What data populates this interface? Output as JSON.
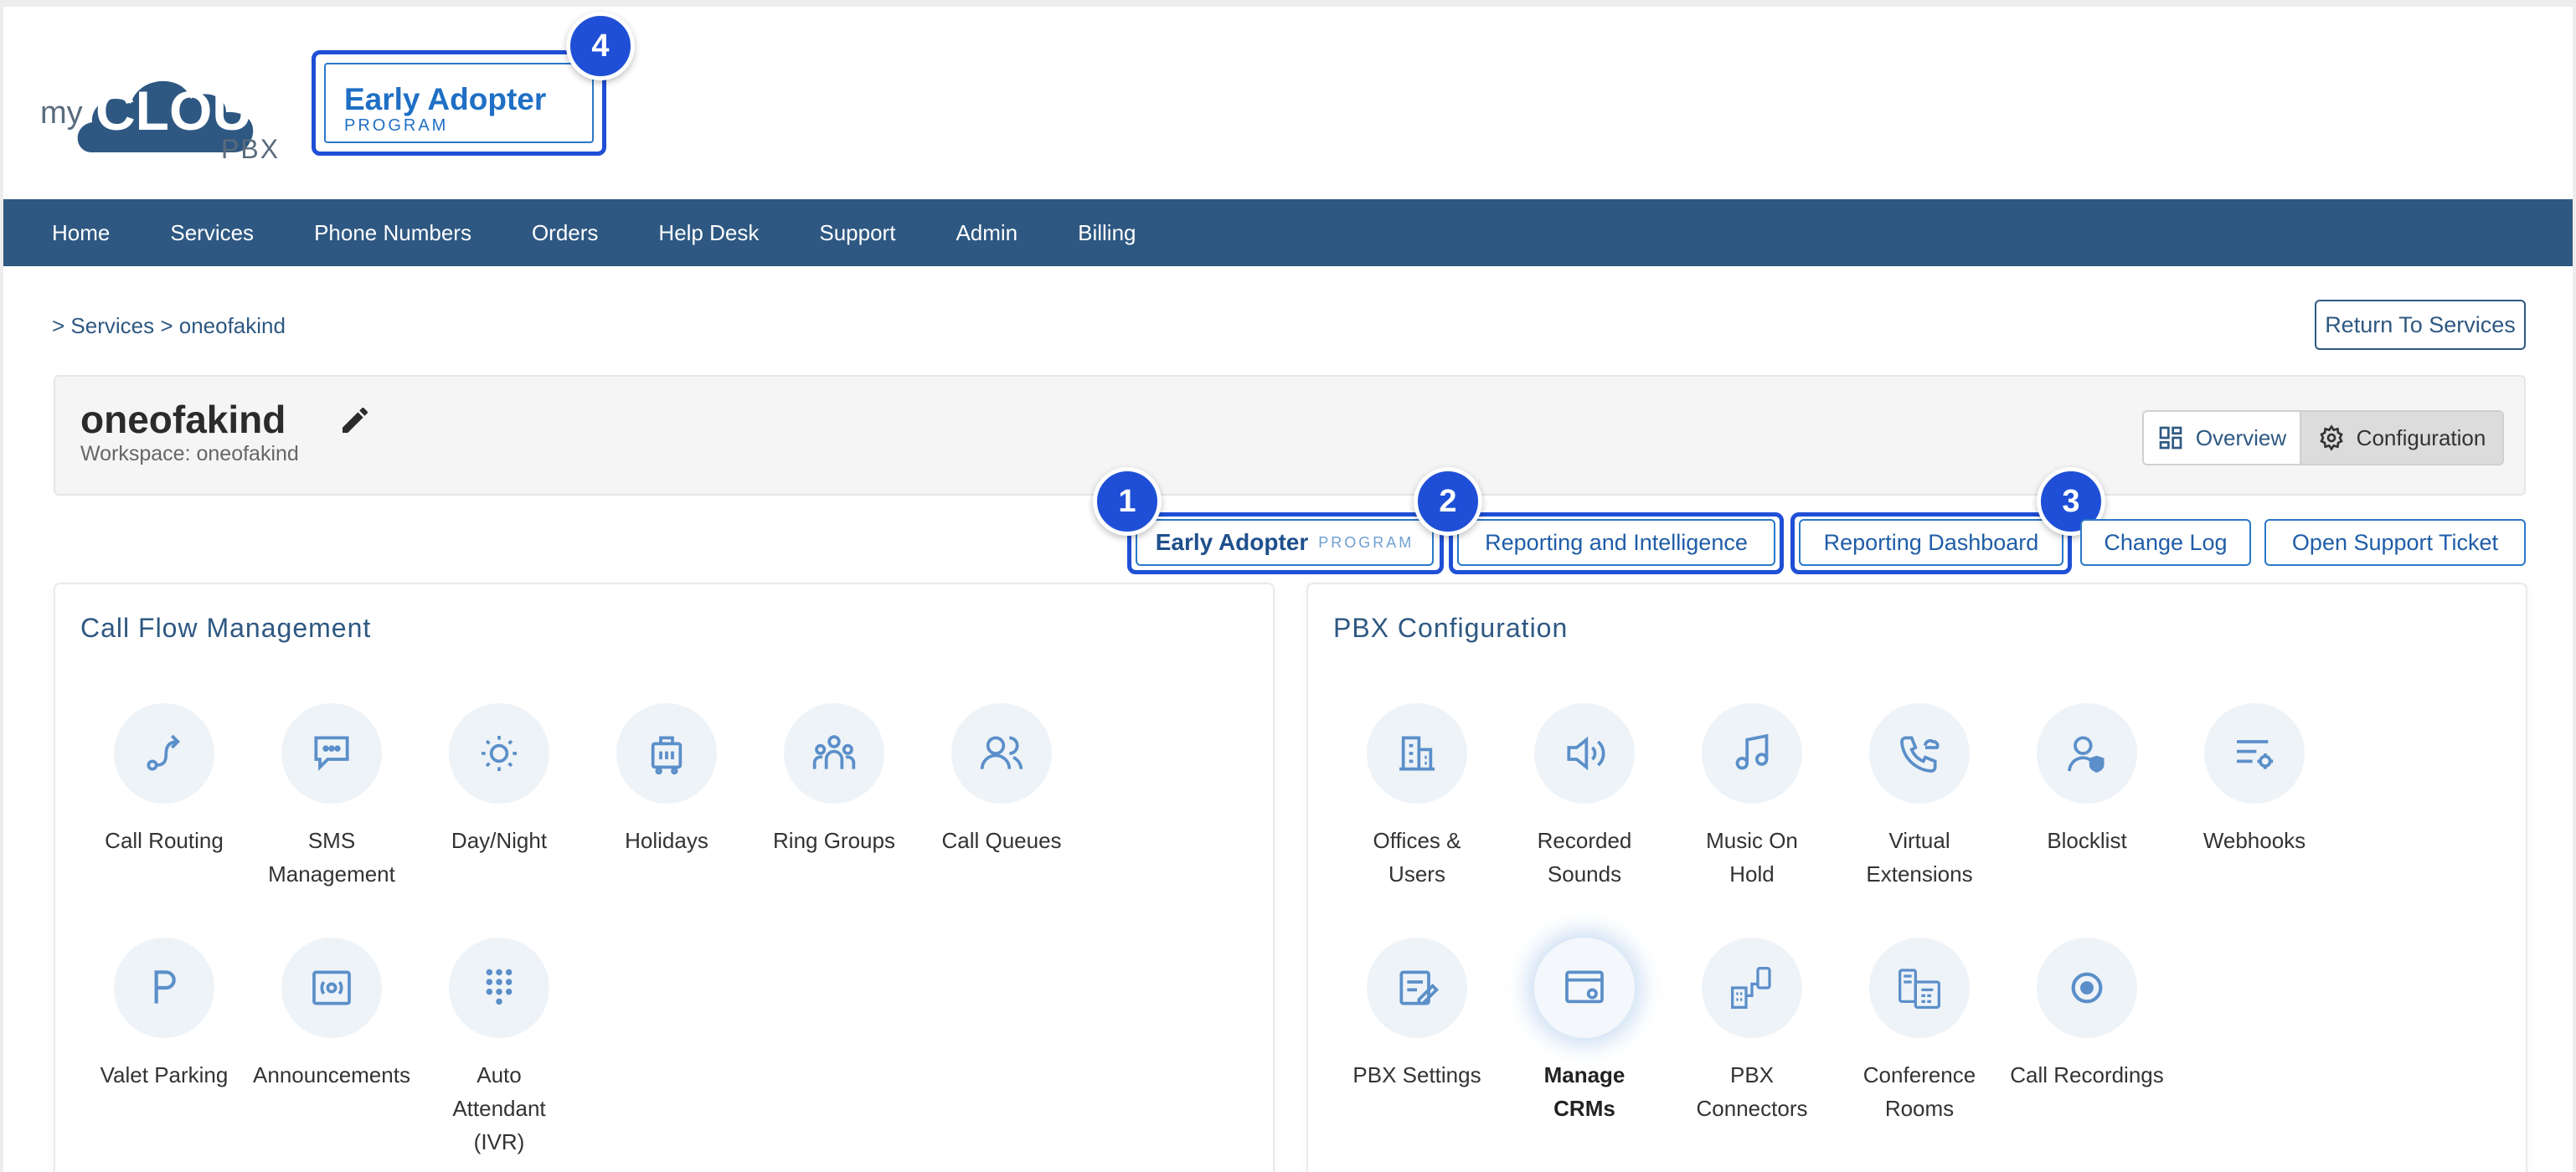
{
  "logo": {
    "my": "my",
    "cloud": "CLOUD",
    "pbx": "PBX"
  },
  "header_badge": {
    "title": "Early Adopter",
    "subtitle": "PROGRAM"
  },
  "callouts": [
    "1",
    "2",
    "3",
    "4"
  ],
  "nav": [
    "Home",
    "Services",
    "Phone Numbers",
    "Orders",
    "Help Desk",
    "Support",
    "Admin",
    "Billing"
  ],
  "breadcrumb": {
    "text": "> Services > oneofakind"
  },
  "return_button": "Return To Services",
  "workspace": {
    "title": "oneofakind",
    "subtitle": "Workspace: oneofakind"
  },
  "view_toggle": {
    "overview": "Overview",
    "configuration": "Configuration",
    "selected": "Configuration"
  },
  "actions": {
    "early_adopter_title": "Early Adopter",
    "early_adopter_sub": "PROGRAM",
    "reporting_intelligence": "Reporting and Intelligence",
    "reporting_dashboard": "Reporting Dashboard",
    "change_log": "Change Log",
    "support_ticket": "Open Support Ticket"
  },
  "call_flow": {
    "title": "Call Flow Management",
    "tiles": [
      {
        "label": "Call Routing",
        "icon": "call-routing-icon"
      },
      {
        "label": "SMS Management",
        "icon": "sms-icon"
      },
      {
        "label": "Day/Night",
        "icon": "day-night-icon"
      },
      {
        "label": "Holidays",
        "icon": "holidays-icon"
      },
      {
        "label": "Ring Groups",
        "icon": "ring-groups-icon"
      },
      {
        "label": "Call Queues",
        "icon": "call-queues-icon"
      },
      {
        "label": "Valet Parking",
        "icon": "valet-parking-icon"
      },
      {
        "label": "Announcements",
        "icon": "announcements-icon"
      },
      {
        "label": "Auto Attendant (IVR)",
        "icon": "keypad-icon"
      }
    ]
  },
  "pbx_config": {
    "title": "PBX Configuration",
    "tiles": [
      {
        "label": "Offices & Users",
        "icon": "offices-icon"
      },
      {
        "label": "Recorded Sounds",
        "icon": "speaker-icon"
      },
      {
        "label": "Music On Hold",
        "icon": "music-icon"
      },
      {
        "label": "Virtual Extensions",
        "icon": "virtual-extension-icon"
      },
      {
        "label": "Blocklist",
        "icon": "blocklist-icon"
      },
      {
        "label": "Webhooks",
        "icon": "webhooks-icon"
      },
      {
        "label": "PBX Settings",
        "icon": "pbx-settings-icon"
      },
      {
        "label": "Manage CRMs",
        "icon": "crm-icon"
      },
      {
        "label": "PBX Connectors",
        "icon": "connectors-icon"
      },
      {
        "label": "Conference Rooms",
        "icon": "conference-icon"
      },
      {
        "label": "Call Recordings",
        "icon": "recording-icon"
      }
    ]
  },
  "colors": {
    "nav_bg": "#2e5882",
    "highlight": "#1f4fd6",
    "icon": "#5b8fc9"
  }
}
